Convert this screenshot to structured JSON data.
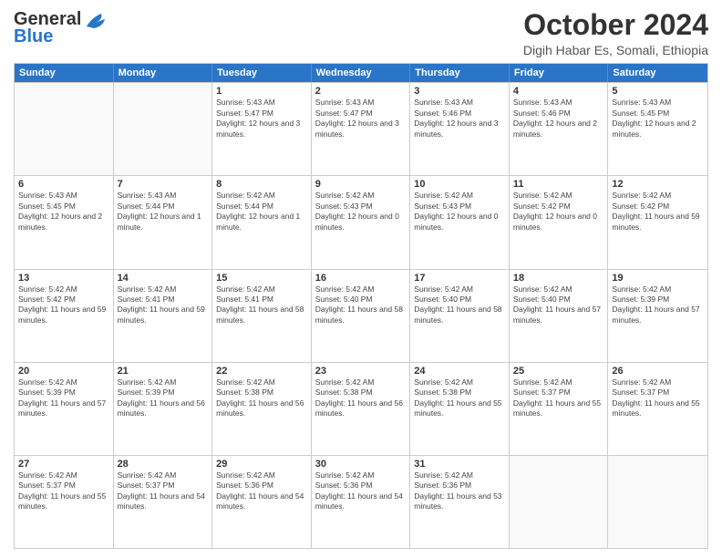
{
  "logo": {
    "line1": "General",
    "line2": "Blue"
  },
  "title": "October 2024",
  "subtitle": "Digih Habar Es, Somali, Ethiopia",
  "header_days": [
    "Sunday",
    "Monday",
    "Tuesday",
    "Wednesday",
    "Thursday",
    "Friday",
    "Saturday"
  ],
  "weeks": [
    [
      {
        "day": "",
        "sunrise": "",
        "sunset": "",
        "daylight": ""
      },
      {
        "day": "",
        "sunrise": "",
        "sunset": "",
        "daylight": ""
      },
      {
        "day": "1",
        "sunrise": "Sunrise: 5:43 AM",
        "sunset": "Sunset: 5:47 PM",
        "daylight": "Daylight: 12 hours and 3 minutes."
      },
      {
        "day": "2",
        "sunrise": "Sunrise: 5:43 AM",
        "sunset": "Sunset: 5:47 PM",
        "daylight": "Daylight: 12 hours and 3 minutes."
      },
      {
        "day": "3",
        "sunrise": "Sunrise: 5:43 AM",
        "sunset": "Sunset: 5:46 PM",
        "daylight": "Daylight: 12 hours and 3 minutes."
      },
      {
        "day": "4",
        "sunrise": "Sunrise: 5:43 AM",
        "sunset": "Sunset: 5:46 PM",
        "daylight": "Daylight: 12 hours and 2 minutes."
      },
      {
        "day": "5",
        "sunrise": "Sunrise: 5:43 AM",
        "sunset": "Sunset: 5:45 PM",
        "daylight": "Daylight: 12 hours and 2 minutes."
      }
    ],
    [
      {
        "day": "6",
        "sunrise": "Sunrise: 5:43 AM",
        "sunset": "Sunset: 5:45 PM",
        "daylight": "Daylight: 12 hours and 2 minutes."
      },
      {
        "day": "7",
        "sunrise": "Sunrise: 5:43 AM",
        "sunset": "Sunset: 5:44 PM",
        "daylight": "Daylight: 12 hours and 1 minute."
      },
      {
        "day": "8",
        "sunrise": "Sunrise: 5:42 AM",
        "sunset": "Sunset: 5:44 PM",
        "daylight": "Daylight: 12 hours and 1 minute."
      },
      {
        "day": "9",
        "sunrise": "Sunrise: 5:42 AM",
        "sunset": "Sunset: 5:43 PM",
        "daylight": "Daylight: 12 hours and 0 minutes."
      },
      {
        "day": "10",
        "sunrise": "Sunrise: 5:42 AM",
        "sunset": "Sunset: 5:43 PM",
        "daylight": "Daylight: 12 hours and 0 minutes."
      },
      {
        "day": "11",
        "sunrise": "Sunrise: 5:42 AM",
        "sunset": "Sunset: 5:42 PM",
        "daylight": "Daylight: 12 hours and 0 minutes."
      },
      {
        "day": "12",
        "sunrise": "Sunrise: 5:42 AM",
        "sunset": "Sunset: 5:42 PM",
        "daylight": "Daylight: 11 hours and 59 minutes."
      }
    ],
    [
      {
        "day": "13",
        "sunrise": "Sunrise: 5:42 AM",
        "sunset": "Sunset: 5:42 PM",
        "daylight": "Daylight: 11 hours and 59 minutes."
      },
      {
        "day": "14",
        "sunrise": "Sunrise: 5:42 AM",
        "sunset": "Sunset: 5:41 PM",
        "daylight": "Daylight: 11 hours and 59 minutes."
      },
      {
        "day": "15",
        "sunrise": "Sunrise: 5:42 AM",
        "sunset": "Sunset: 5:41 PM",
        "daylight": "Daylight: 11 hours and 58 minutes."
      },
      {
        "day": "16",
        "sunrise": "Sunrise: 5:42 AM",
        "sunset": "Sunset: 5:40 PM",
        "daylight": "Daylight: 11 hours and 58 minutes."
      },
      {
        "day": "17",
        "sunrise": "Sunrise: 5:42 AM",
        "sunset": "Sunset: 5:40 PM",
        "daylight": "Daylight: 11 hours and 58 minutes."
      },
      {
        "day": "18",
        "sunrise": "Sunrise: 5:42 AM",
        "sunset": "Sunset: 5:40 PM",
        "daylight": "Daylight: 11 hours and 57 minutes."
      },
      {
        "day": "19",
        "sunrise": "Sunrise: 5:42 AM",
        "sunset": "Sunset: 5:39 PM",
        "daylight": "Daylight: 11 hours and 57 minutes."
      }
    ],
    [
      {
        "day": "20",
        "sunrise": "Sunrise: 5:42 AM",
        "sunset": "Sunset: 5:39 PM",
        "daylight": "Daylight: 11 hours and 57 minutes."
      },
      {
        "day": "21",
        "sunrise": "Sunrise: 5:42 AM",
        "sunset": "Sunset: 5:39 PM",
        "daylight": "Daylight: 11 hours and 56 minutes."
      },
      {
        "day": "22",
        "sunrise": "Sunrise: 5:42 AM",
        "sunset": "Sunset: 5:38 PM",
        "daylight": "Daylight: 11 hours and 56 minutes."
      },
      {
        "day": "23",
        "sunrise": "Sunrise: 5:42 AM",
        "sunset": "Sunset: 5:38 PM",
        "daylight": "Daylight: 11 hours and 56 minutes."
      },
      {
        "day": "24",
        "sunrise": "Sunrise: 5:42 AM",
        "sunset": "Sunset: 5:38 PM",
        "daylight": "Daylight: 11 hours and 55 minutes."
      },
      {
        "day": "25",
        "sunrise": "Sunrise: 5:42 AM",
        "sunset": "Sunset: 5:37 PM",
        "daylight": "Daylight: 11 hours and 55 minutes."
      },
      {
        "day": "26",
        "sunrise": "Sunrise: 5:42 AM",
        "sunset": "Sunset: 5:37 PM",
        "daylight": "Daylight: 11 hours and 55 minutes."
      }
    ],
    [
      {
        "day": "27",
        "sunrise": "Sunrise: 5:42 AM",
        "sunset": "Sunset: 5:37 PM",
        "daylight": "Daylight: 11 hours and 55 minutes."
      },
      {
        "day": "28",
        "sunrise": "Sunrise: 5:42 AM",
        "sunset": "Sunset: 5:37 PM",
        "daylight": "Daylight: 11 hours and 54 minutes."
      },
      {
        "day": "29",
        "sunrise": "Sunrise: 5:42 AM",
        "sunset": "Sunset: 5:36 PM",
        "daylight": "Daylight: 11 hours and 54 minutes."
      },
      {
        "day": "30",
        "sunrise": "Sunrise: 5:42 AM",
        "sunset": "Sunset: 5:36 PM",
        "daylight": "Daylight: 11 hours and 54 minutes."
      },
      {
        "day": "31",
        "sunrise": "Sunrise: 5:42 AM",
        "sunset": "Sunset: 5:36 PM",
        "daylight": "Daylight: 11 hours and 53 minutes."
      },
      {
        "day": "",
        "sunrise": "",
        "sunset": "",
        "daylight": ""
      },
      {
        "day": "",
        "sunrise": "",
        "sunset": "",
        "daylight": ""
      }
    ]
  ]
}
